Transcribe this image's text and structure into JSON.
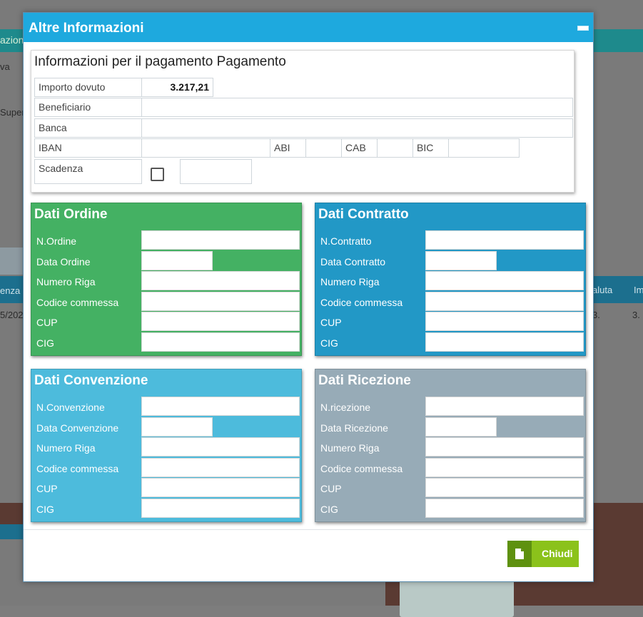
{
  "background": {
    "app_tab_fragment": "azion",
    "toolbar_fragment": "va",
    "field_fragment": "Superi",
    "col_left_fragment": "enza",
    "date_fragment": "5/202",
    "col_right_1": "aluta",
    "col_right_2": "Im",
    "val_right_1": "3.",
    "val_right_2": "3."
  },
  "dialog": {
    "title": "Altre Informazioni",
    "payment": {
      "title": "Informazioni per il pagamento Pagamento",
      "amount_label": "Importo dovuto",
      "amount_value": "3.217,21",
      "beneficiary_label": "Beneficiario",
      "bank_label": "Banca",
      "iban_label": "IBAN",
      "abi_label": "ABI",
      "cab_label": "CAB",
      "bic_label": "BIC",
      "due_label": "Scadenza"
    },
    "panels": [
      {
        "title": "Dati Ordine",
        "color": "#44b163",
        "fields": [
          "N.Ordine",
          "Data Ordine",
          "Numero Riga",
          "Codice commessa",
          "CUP",
          "CIG"
        ]
      },
      {
        "title": "Dati Contratto",
        "color": "#2298c6",
        "fields": [
          "N.Contratto",
          "Data Contratto",
          "Numero Riga",
          "Codice commessa",
          "CUP",
          "CIG"
        ]
      },
      {
        "title": "Dati Convenzione",
        "color": "#4dbbdc",
        "fields": [
          "N.Convenzione",
          "Data Convenzione",
          "Numero Riga",
          "Codice commessa",
          "CUP",
          "CIG"
        ]
      },
      {
        "title": "Dati Ricezione",
        "color": "#97abb7",
        "fields": [
          "N.ricezione",
          "Data Ricezione",
          "Numero Riga",
          "Codice commessa",
          "CUP",
          "CIG"
        ]
      }
    ],
    "close_label": "Chiudi",
    "close_icon": "document-icon"
  }
}
